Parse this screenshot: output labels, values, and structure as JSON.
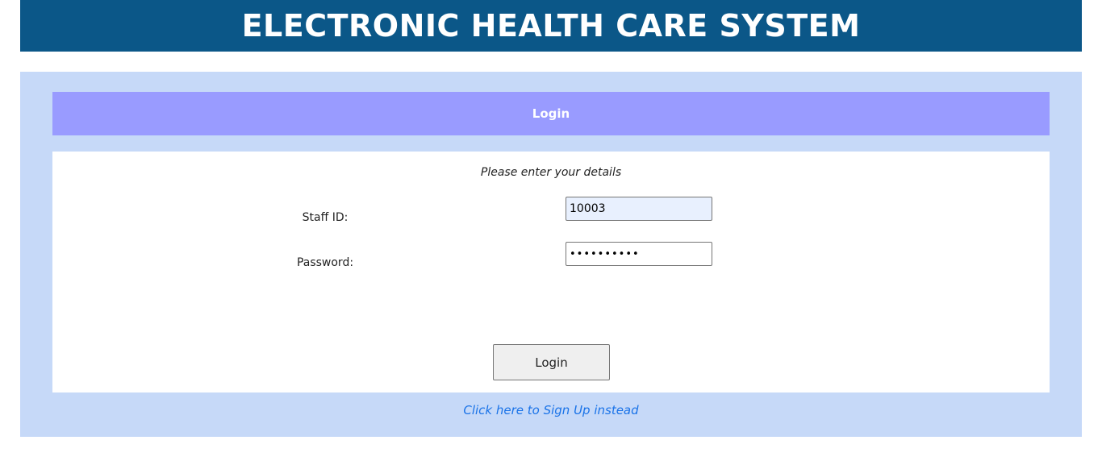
{
  "header": {
    "title": "ELECTRONIC HEALTH CARE SYSTEM"
  },
  "login_panel": {
    "title": "Login",
    "instructions": "Please enter your details",
    "staff_id": {
      "label": "Staff ID:",
      "value": "10003"
    },
    "password": {
      "label": "Password:",
      "value": "••••••••••"
    },
    "submit_label": "Login",
    "signup_link": "Click here to Sign Up instead"
  },
  "colors": {
    "header_bg": "#0b5788",
    "panel_bg": "#c6d9f8",
    "title_bar_bg": "#999bff",
    "link": "#1a73e8",
    "autofill_bg": "#e8f0fe"
  }
}
